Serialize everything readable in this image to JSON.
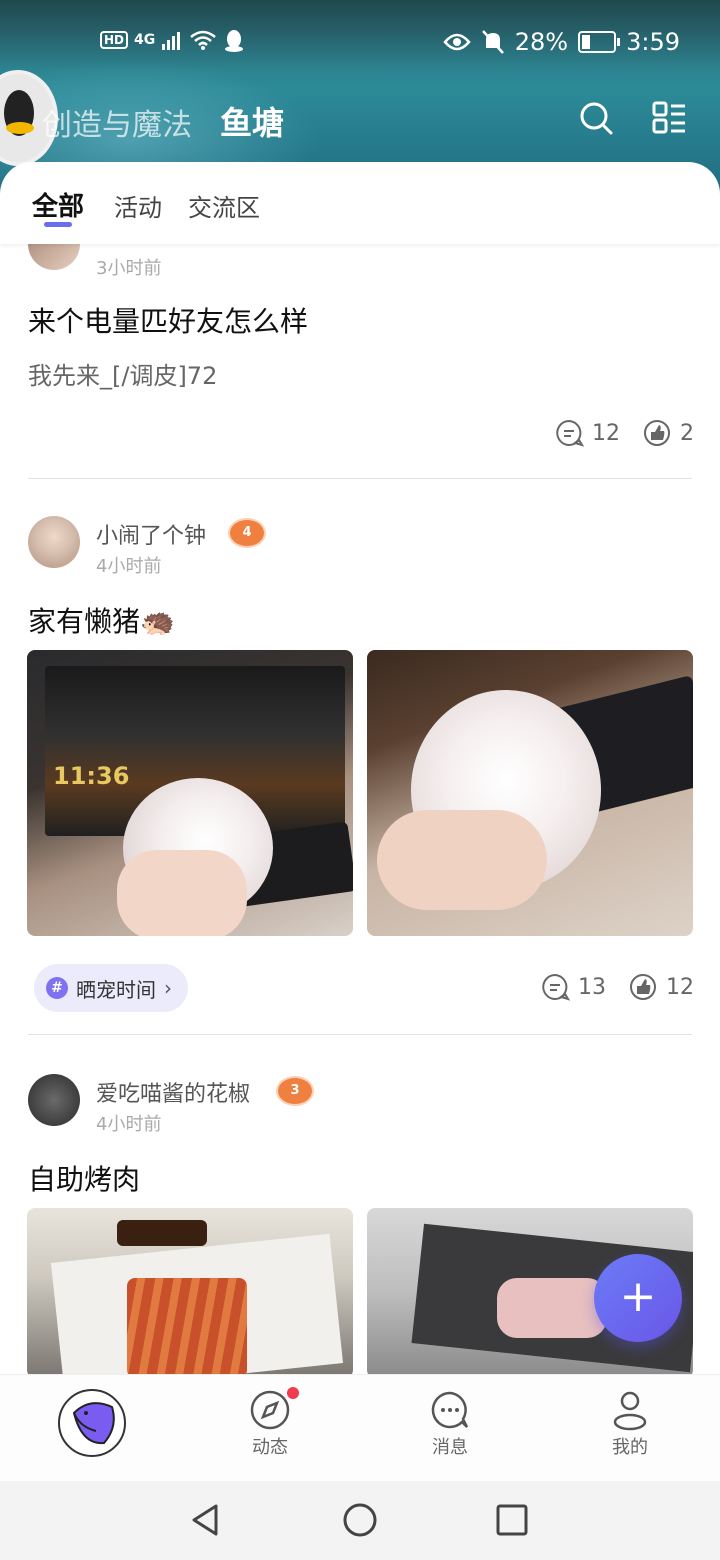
{
  "status_bar": {
    "hd": "HD",
    "network": "4G",
    "battery": "28%",
    "battery_level": 0.28,
    "time": "3:59"
  },
  "header": {
    "tab_inactive": "创造与魔法",
    "tab_active": "鱼塘"
  },
  "sub_tabs": [
    {
      "label": "全部",
      "active": true
    },
    {
      "label": "活动",
      "active": false
    },
    {
      "label": "交流区",
      "active": false
    }
  ],
  "posts": [
    {
      "time": "3小时前",
      "title": "来个电量匹好友怎么样",
      "body": "我先来_[/调皮]72",
      "comments": "12",
      "likes": "2"
    },
    {
      "user": "小闹了个钟",
      "level": "4",
      "time": "4小时前",
      "title": "家有懒猪🦔",
      "topic": "晒宠时间",
      "comments": "13",
      "likes": "12"
    },
    {
      "user": "爱吃喵酱的花椒",
      "level": "3",
      "time": "4小时前",
      "title": "自助烤肉"
    }
  ],
  "photo_text": {
    "clock": "11:36"
  },
  "fab": {
    "label": "+"
  },
  "bottom_nav": {
    "items": [
      {
        "label": "动态",
        "has_badge": true
      },
      {
        "label": "消息",
        "has_badge": false
      },
      {
        "label": "我的",
        "has_badge": false
      }
    ]
  },
  "colors": {
    "accent": "#6c6cf0",
    "badge": "#f03c4c",
    "level_badge": "#f08040"
  }
}
